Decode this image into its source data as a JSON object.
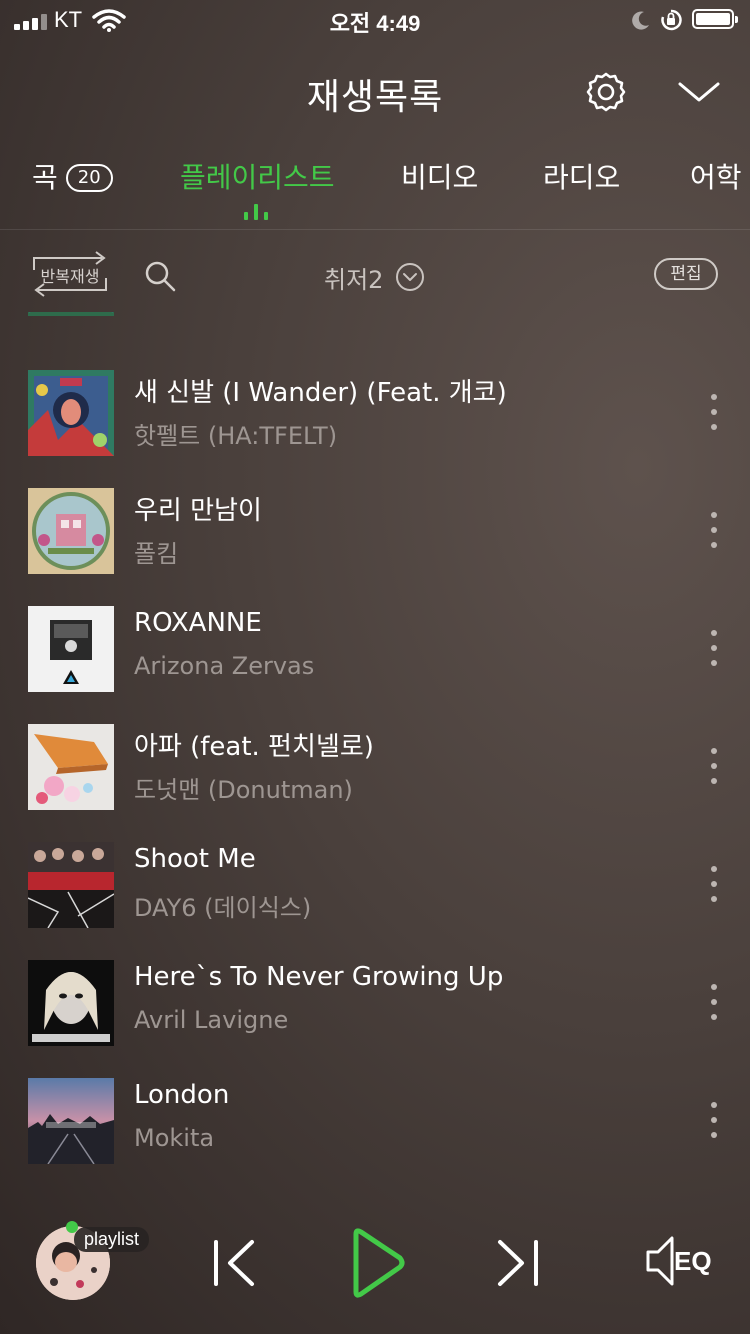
{
  "status_bar": {
    "carrier": "KT",
    "time": "오전 4:49"
  },
  "header": {
    "title": "재생목록"
  },
  "tabs": [
    {
      "label": "곡",
      "count": "20"
    },
    {
      "label": "플레이리스트",
      "active": true
    },
    {
      "label": "비디오"
    },
    {
      "label": "라디오"
    },
    {
      "label": "어학"
    }
  ],
  "toolbar": {
    "repeat_label": "반복재생",
    "playlist_name": "취저2",
    "edit_label": "편집"
  },
  "songs": [
    {
      "title": "새 신발 (I Wander) (Feat. 개코)",
      "artist": "핫펠트 (HA:TFELT)"
    },
    {
      "title": "우리 만남이",
      "artist": "폴킴"
    },
    {
      "title": "ROXANNE",
      "artist": "Arizona Zervas"
    },
    {
      "title": "아파 (feat. 펀치넬로)",
      "artist": "도넛맨 (Donutman)"
    },
    {
      "title": "Shoot Me",
      "artist": "DAY6 (데이식스)"
    },
    {
      "title": "Here`s To Never Growing Up",
      "artist": "Avril Lavigne"
    },
    {
      "title": "London",
      "artist": "Mokita"
    }
  ],
  "player": {
    "playlist_chip": "playlist",
    "eq_label": "EQ"
  },
  "colors": {
    "accent": "#43c948",
    "background": "#4a403c"
  }
}
